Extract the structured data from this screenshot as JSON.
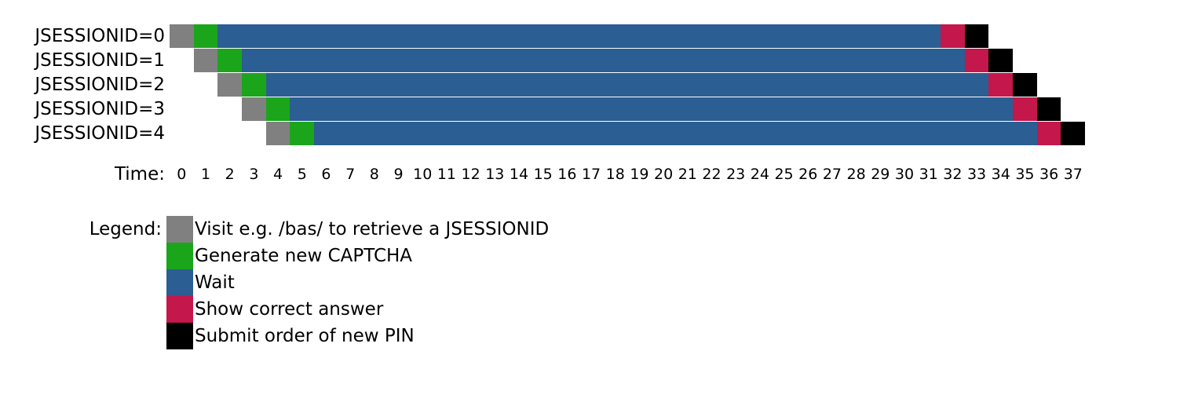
{
  "chart_data": {
    "type": "bar",
    "unit_width": 1,
    "time_ticks": [
      0,
      1,
      2,
      3,
      4,
      5,
      6,
      7,
      8,
      9,
      10,
      11,
      12,
      13,
      14,
      15,
      16,
      17,
      18,
      19,
      20,
      21,
      22,
      23,
      24,
      25,
      26,
      27,
      28,
      29,
      30,
      31,
      32,
      33,
      34,
      35,
      36,
      37
    ],
    "time_label": "Time:",
    "colors": {
      "visit": "#808080",
      "captcha": "#1ba51b",
      "wait": "#2b5e92",
      "answer": "#c4174c",
      "submit": "#000000"
    },
    "series": [
      {
        "name": "JSESSIONID=0",
        "segments": [
          {
            "state": "visit",
            "start": 0,
            "len": 1
          },
          {
            "state": "captcha",
            "start": 1,
            "len": 1
          },
          {
            "state": "wait",
            "start": 2,
            "len": 30
          },
          {
            "state": "answer",
            "start": 32,
            "len": 1
          },
          {
            "state": "submit",
            "start": 33,
            "len": 1
          }
        ]
      },
      {
        "name": "JSESSIONID=1",
        "segments": [
          {
            "state": "visit",
            "start": 1,
            "len": 1
          },
          {
            "state": "captcha",
            "start": 2,
            "len": 1
          },
          {
            "state": "wait",
            "start": 3,
            "len": 30
          },
          {
            "state": "answer",
            "start": 33,
            "len": 1
          },
          {
            "state": "submit",
            "start": 34,
            "len": 1
          }
        ]
      },
      {
        "name": "JSESSIONID=2",
        "segments": [
          {
            "state": "visit",
            "start": 2,
            "len": 1
          },
          {
            "state": "captcha",
            "start": 3,
            "len": 1
          },
          {
            "state": "wait",
            "start": 4,
            "len": 30
          },
          {
            "state": "answer",
            "start": 34,
            "len": 1
          },
          {
            "state": "submit",
            "start": 35,
            "len": 1
          }
        ]
      },
      {
        "name": "JSESSIONID=3",
        "segments": [
          {
            "state": "visit",
            "start": 3,
            "len": 1
          },
          {
            "state": "captcha",
            "start": 4,
            "len": 1
          },
          {
            "state": "wait",
            "start": 5,
            "len": 30
          },
          {
            "state": "answer",
            "start": 35,
            "len": 1
          },
          {
            "state": "submit",
            "start": 36,
            "len": 1
          }
        ]
      },
      {
        "name": "JSESSIONID=4",
        "segments": [
          {
            "state": "visit",
            "start": 4,
            "len": 1
          },
          {
            "state": "captcha",
            "start": 5,
            "len": 1
          },
          {
            "state": "wait",
            "start": 6,
            "len": 30
          },
          {
            "state": "answer",
            "start": 36,
            "len": 1
          },
          {
            "state": "submit",
            "start": 37,
            "len": 1
          }
        ]
      }
    ],
    "legend_label": "Legend:",
    "legend": [
      {
        "state": "visit",
        "text": "Visit e.g. /bas/ to retrieve a JSESSIONID"
      },
      {
        "state": "captcha",
        "text": "Generate new CAPTCHA"
      },
      {
        "state": "wait",
        "text": "Wait"
      },
      {
        "state": "answer",
        "text": "Show correct answer"
      },
      {
        "state": "submit",
        "text": "Submit order of new PIN"
      }
    ]
  }
}
